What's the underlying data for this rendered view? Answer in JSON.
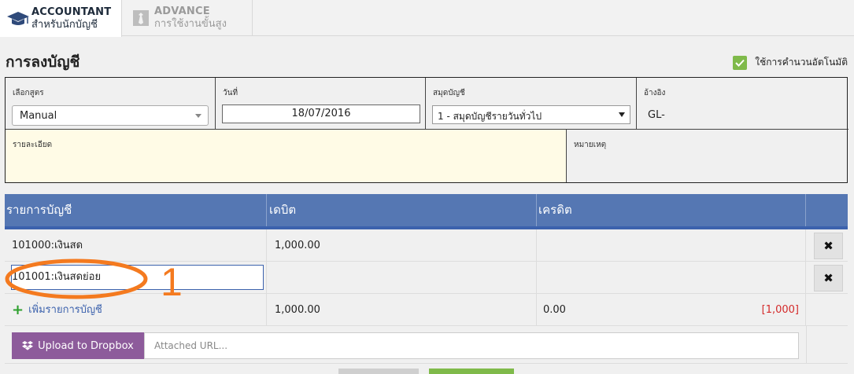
{
  "tabs": [
    {
      "title": "ACCOUNTANT",
      "subtitle": "สำหรับนักบัญชี",
      "icon": "graduation-cap-icon",
      "active": true
    },
    {
      "title": "ADVANCE",
      "subtitle": "การใช้งานขั้นสูง",
      "icon": "tie-icon",
      "active": false
    }
  ],
  "page": {
    "title": "การลงบัญชี",
    "auto_calc_label": "ใช้การคำนวนอัตโนมัติ",
    "auto_calc_checked": true
  },
  "form": {
    "formula": {
      "label": "เลือกสูตร",
      "value": "Manual"
    },
    "date": {
      "label": "วันที่",
      "value": "18/07/2016"
    },
    "book": {
      "label": "สมุดบัญชี",
      "value": "1 - สมุดบัญชีรายวันทั่วไป"
    },
    "reference": {
      "label": "อ้างอิง",
      "value": "GL-"
    },
    "description": {
      "label": "รายละเอียด",
      "value": ""
    },
    "note": {
      "label": "หมายเหตุ",
      "value": ""
    }
  },
  "table": {
    "headers": {
      "account": "รายการบัญชี",
      "debit": "เดบิต",
      "credit": "เครดิต"
    },
    "rows": [
      {
        "account": "101000:เงินสด",
        "debit": "1,000.00",
        "credit": ""
      },
      {
        "account": "101001:เงินสดย่อย",
        "debit": "",
        "credit": ""
      }
    ],
    "add_label": "เพิ่มรายการบัญชี",
    "total_debit": "1,000.00",
    "total_credit": "0.00",
    "difference": "[1,000]",
    "delete_symbol": "✖"
  },
  "upload": {
    "button_label": "Upload to Dropbox",
    "url_placeholder": "Attached URL..."
  },
  "annotation": {
    "number": "1",
    "color": "#f47a1f"
  },
  "colors": {
    "header_blue": "#5577b3",
    "accent_green": "#7fba4a",
    "dropbox_purple": "#8d5b9b",
    "diff_red": "#d42a2a",
    "description_bg": "#fffbe6"
  }
}
